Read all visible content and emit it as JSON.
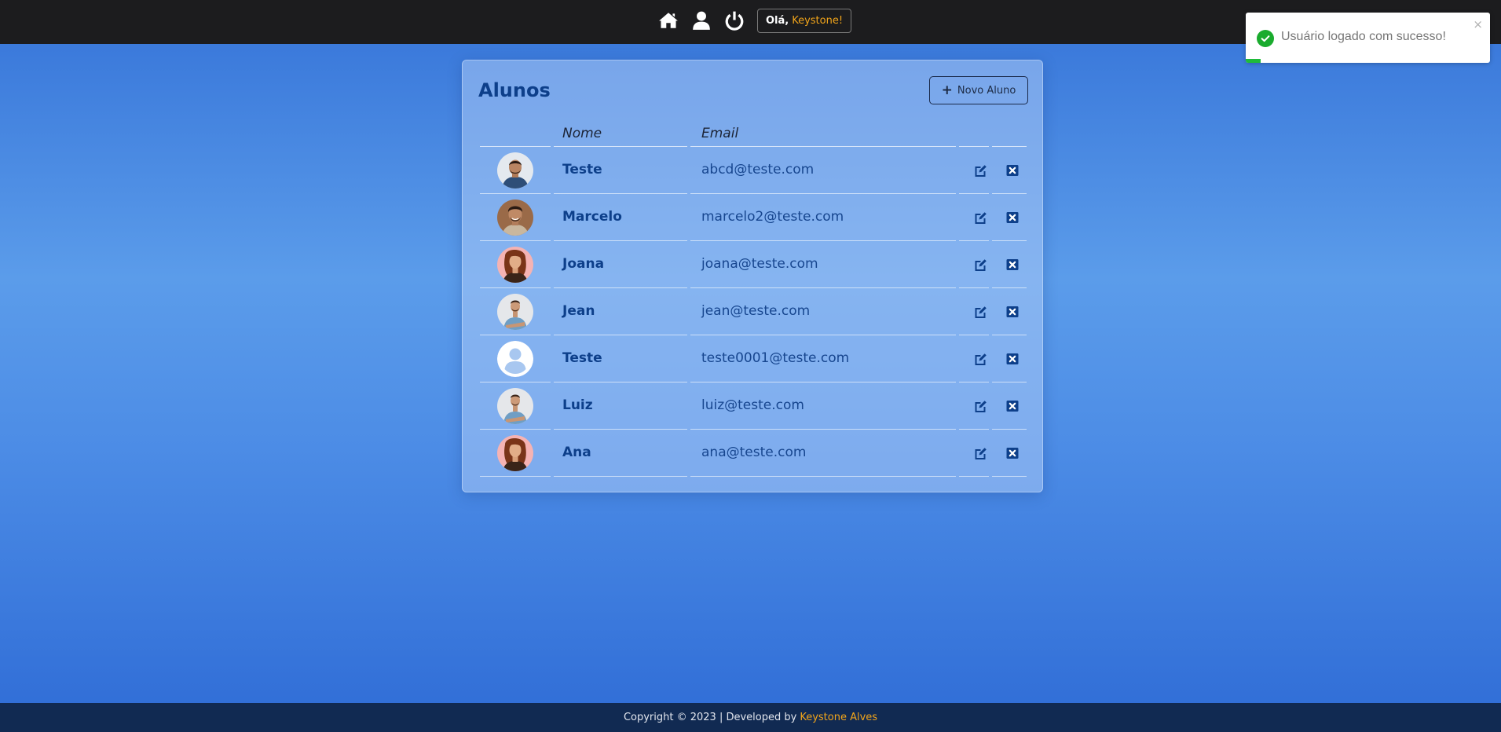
{
  "nav": {
    "icons": [
      "home-icon",
      "user-icon",
      "power-icon"
    ],
    "greeting_prefix": "Olá,",
    "greeting_name": "Keystone!"
  },
  "toast": {
    "message": "Usuário logado com sucesso!",
    "close": "×",
    "progress": 0.06
  },
  "card": {
    "title": "Alunos",
    "new_button": "Novo Aluno",
    "columns": {
      "name": "Nome",
      "email": "Email"
    },
    "rows": [
      {
        "name": "Teste",
        "email": "abcd@teste.com",
        "avatar": "photo-man-blue-shirt"
      },
      {
        "name": "Marcelo",
        "email": "marcelo2@teste.com",
        "avatar": "photo-man-brown-bg"
      },
      {
        "name": "Joana",
        "email": "joana@teste.com",
        "avatar": "photo-woman-pink-bg"
      },
      {
        "name": "Jean",
        "email": "jean@teste.com",
        "avatar": "photo-man-crossed-arms"
      },
      {
        "name": "Teste",
        "email": "teste0001@teste.com",
        "avatar": "default-user-icon"
      },
      {
        "name": "Luiz",
        "email": "luiz@teste.com",
        "avatar": "photo-man-crossed-arms"
      },
      {
        "name": "Ana",
        "email": "ana@teste.com",
        "avatar": "photo-woman-pink-bg"
      }
    ]
  },
  "footer": {
    "text": "Copyright © 2023 | Developed by",
    "author": "Keystone Alves"
  },
  "colors": {
    "accent": "#f2a51a",
    "title": "#0d3f8a",
    "success": "#1aab2e",
    "topbar": "#1c1c1e",
    "footer": "#112a52"
  }
}
